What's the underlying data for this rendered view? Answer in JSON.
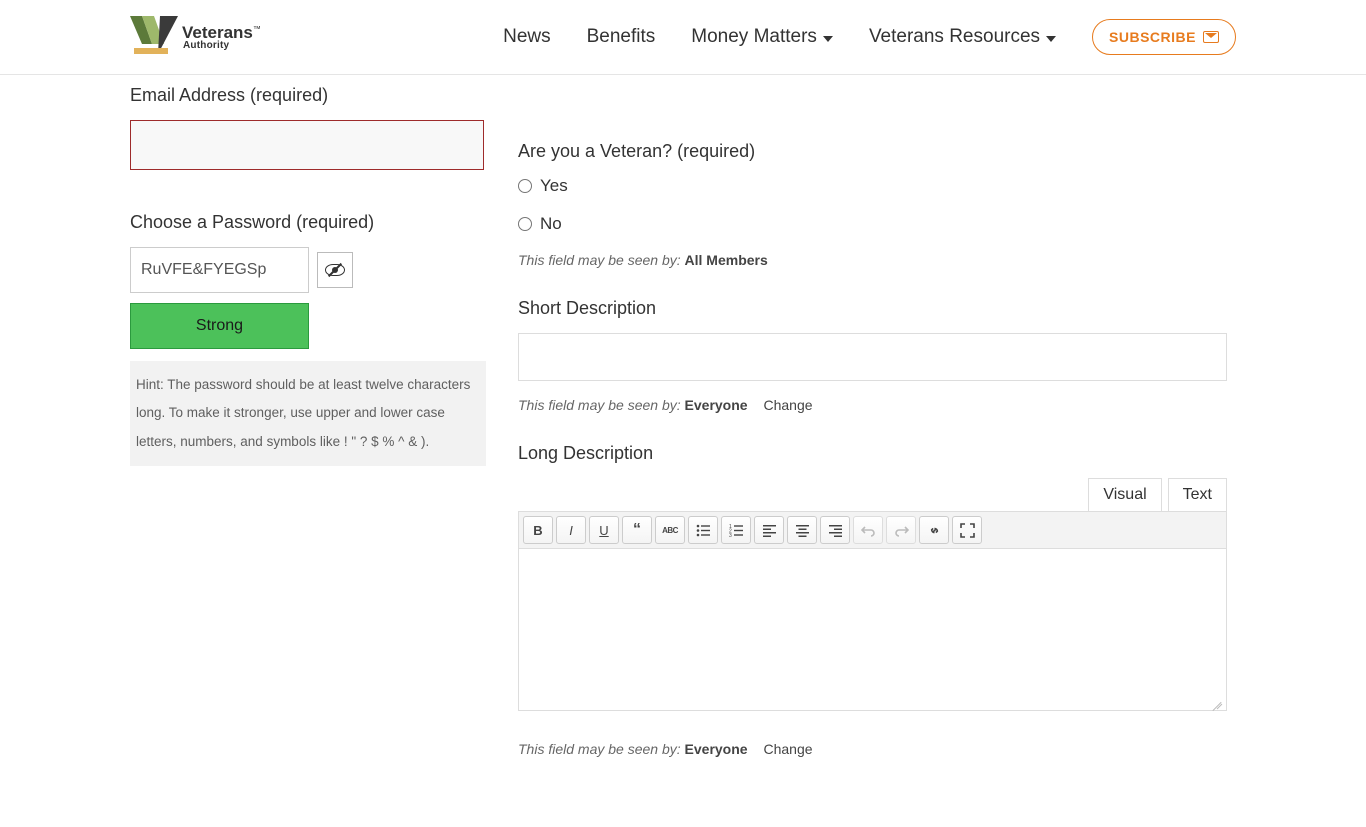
{
  "header": {
    "logo": {
      "line1": "Veterans",
      "tm": "™",
      "line2": "Authority"
    },
    "nav": {
      "news": "News",
      "benefits": "Benefits",
      "money": "Money Matters",
      "resources": "Veterans Resources"
    },
    "subscribe": "SUBSCRIBE"
  },
  "left": {
    "email_label": "Email Address (required)",
    "email_value": "",
    "password_label": "Choose a Password (required)",
    "password_value": "RuVFE&FYEGSp",
    "strength": "Strong",
    "hint": "Hint: The password should be at least twelve characters long. To make it stronger, use upper and lower case letters, numbers, and symbols like ! \" ? $ % ^ & )."
  },
  "right": {
    "veteran": {
      "label": "Are you a Veteran? (required)",
      "yes": "Yes",
      "no": "No",
      "vis_prefix": "This field may be seen by:",
      "vis_value": "All Members"
    },
    "short": {
      "label": "Short Description",
      "vis_prefix": "This field may be seen by:",
      "vis_value": "Everyone",
      "change": "Change"
    },
    "long": {
      "label": "Long Description",
      "tabs": {
        "visual": "Visual",
        "text": "Text"
      },
      "vis_prefix": "This field may be seen by:",
      "vis_value": "Everyone",
      "change": "Change"
    }
  }
}
